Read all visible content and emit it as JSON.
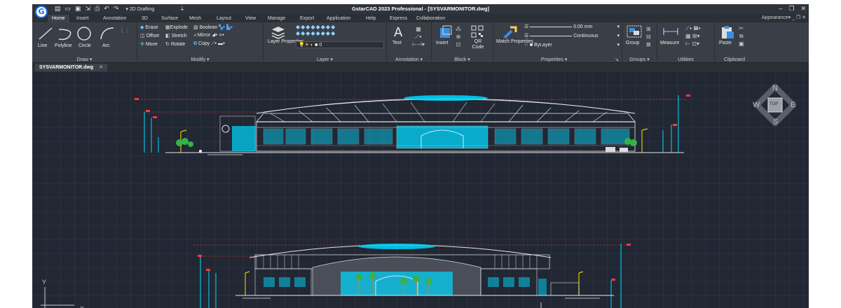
{
  "window": {
    "title": "GstarCAD 2023 Professional - [SYSVARMONITOR.dwg]",
    "workspace": "2D Drafting",
    "appearance": "Appearance"
  },
  "menu_tabs": [
    "Home",
    "Insert",
    "Annotation",
    "3D",
    "Surface",
    "Mesh",
    "Layout",
    "View",
    "Manage",
    "Export",
    "Application",
    "Help",
    "Express",
    "Collaboration"
  ],
  "active_tab": "Home",
  "ribbon": {
    "draw": {
      "label": "Draw",
      "line": "Line",
      "polyline": "Polyline",
      "circle": "Circle",
      "arc": "Arc"
    },
    "modify": {
      "label": "Modify",
      "erase": "Erase",
      "explode": "Explode",
      "boolean": "Boolean",
      "offset": "Offset",
      "stretch": "Stretch",
      "mirror": "Mirror",
      "move": "Move",
      "rotate": "Rotate",
      "copy": "Copy"
    },
    "layer": {
      "label": "Layer",
      "properties": "Layer Properties",
      "current": "0"
    },
    "annotation": {
      "label": "Annotation",
      "text": "Text"
    },
    "block": {
      "label": "Block",
      "insert": "Insert",
      "qrcode": "QR Code"
    },
    "properties": {
      "label": "Properties",
      "match": "Match Properties",
      "lineweight": "0.00 mm",
      "linetype": "Continuous",
      "color": "ByLayer"
    },
    "groups": {
      "label": "Groups",
      "group": "Group"
    },
    "utilities": {
      "label": "Utilities",
      "measure": "Measure"
    },
    "clipboard": {
      "label": "Clipboard",
      "paste": "Paste"
    }
  },
  "document_tab": {
    "name": "SYSVARMONITOR.dwg",
    "close": "✕"
  },
  "nav_cube": {
    "n": "N",
    "s": "S",
    "e": "E",
    "w": "W",
    "face": "TOP"
  },
  "ucs": {
    "x": "X",
    "y": "Y"
  },
  "colors": {
    "cyan": "#00d8ff",
    "red": "#ff3a3a",
    "yellow": "#e6c200",
    "green": "#33b34a",
    "white": "#e6e6e6"
  }
}
